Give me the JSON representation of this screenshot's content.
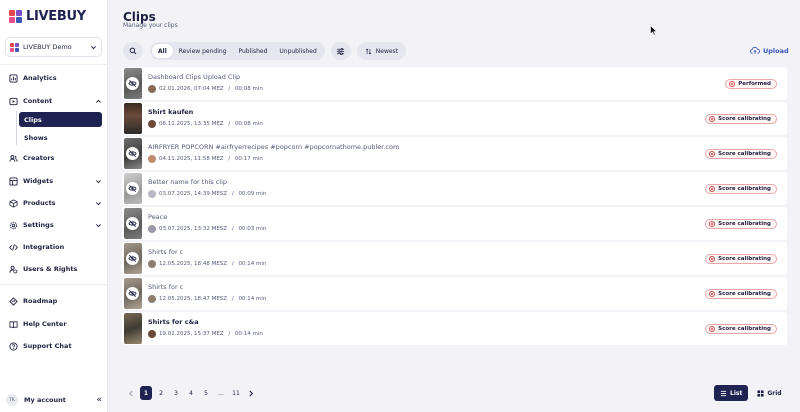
{
  "brand": {
    "name": "LIVEBUY",
    "colors": {
      "navy": "#1f2352",
      "blue": "#3a56b8",
      "red": "#e0474c",
      "purple": "#7a4fc9",
      "pink": "#e84a8a"
    }
  },
  "sidebar": {
    "account": {
      "label": "LIVEBUY Demo",
      "icon": "chevron-down-icon"
    },
    "nav": [
      {
        "label": "Analytics",
        "icon": "analytics-icon"
      },
      {
        "label": "Content",
        "icon": "play-icon",
        "expanded": true
      },
      {
        "label": "Clips",
        "sub": true,
        "active": true
      },
      {
        "label": "Shows",
        "sub": true
      },
      {
        "label": "Creators",
        "icon": "users-icon"
      },
      {
        "label": "Widgets",
        "icon": "widgets-icon"
      },
      {
        "label": "Products",
        "icon": "box-icon"
      },
      {
        "label": "Settings",
        "icon": "gear-icon"
      },
      {
        "label": "Integration",
        "icon": "code-icon"
      },
      {
        "label": "Users & Rights",
        "icon": "user-shield-icon"
      },
      {
        "label": "Roadmap",
        "icon": "roadmap-icon"
      },
      {
        "label": "Help Center",
        "icon": "book-icon"
      },
      {
        "label": "Support Chat",
        "icon": "help-icon"
      }
    ],
    "footer": {
      "initials": "TK",
      "label": "My account",
      "collapse": "«"
    }
  },
  "header": {
    "title": "Clips",
    "subtitle": "Manage your clips"
  },
  "toolbar": {
    "filters": [
      "All",
      "Review pending",
      "Published",
      "Unpublished"
    ],
    "active_filter": "All",
    "sort_label": "Newest",
    "upload_label": "Upload"
  },
  "clips": [
    {
      "title": "Dashboard Clips Upload Clip",
      "date": "02.01.2026, 07:04 MEZ",
      "duration": "00:08 min",
      "status": "Performed",
      "title_bold": false,
      "hidden": true,
      "thumb": "gray"
    },
    {
      "title": "Shirt kaufen",
      "date": "06.11.2025, 13:35 MEZ",
      "duration": "00:08 min",
      "status": "Score calibrating",
      "title_bold": true,
      "hidden": false,
      "thumb": "person"
    },
    {
      "title": "AIRFRYER POPCORN #airfryerrecipes #popcorn #popcornathome.publer.com",
      "date": "04.11.2025, 11:58 MEZ",
      "duration": "00:17 min",
      "status": "Score calibrating",
      "title_bold": false,
      "hidden": true,
      "thumb": "dark"
    },
    {
      "title": "Better name for this clip",
      "date": "03.07.2025, 14:39 MESZ",
      "duration": "00:09 min",
      "status": "Score calibrating",
      "title_bold": false,
      "hidden": true,
      "thumb": "light"
    },
    {
      "title": "Peace",
      "date": "03.07.2025, 13:32 MESZ",
      "duration": "00:03 min",
      "status": "Score calibrating",
      "title_bold": false,
      "hidden": true,
      "thumb": "gray"
    },
    {
      "title": "Shirts for c",
      "date": "12.05.2025, 18:48 MESZ",
      "duration": "00:14 min",
      "status": "Score calibrating",
      "title_bold": false,
      "hidden": true,
      "thumb": "warm"
    },
    {
      "title": "Shirts for c",
      "date": "12.05.2025, 18:47 MESZ",
      "duration": "00:14 min",
      "status": "Score calibrating",
      "title_bold": false,
      "hidden": true,
      "thumb": "warm"
    },
    {
      "title": "Shirts for c&a",
      "date": "19.02.2025, 15:37 MEZ",
      "duration": "00:14 min",
      "status": "Score calibrating",
      "title_bold": true,
      "hidden": false,
      "thumb": "store"
    }
  ],
  "pagination": {
    "pages": [
      "1",
      "2",
      "3",
      "4",
      "5",
      "...",
      "11"
    ],
    "current": "1"
  },
  "view": {
    "list_label": "List",
    "grid_label": "Grid",
    "active": "List"
  }
}
